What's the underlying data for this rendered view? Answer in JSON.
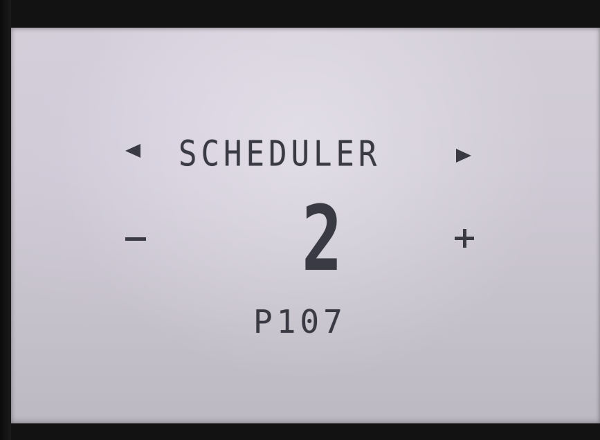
{
  "screen": {
    "title": "SCHEDULER",
    "value": "2",
    "parameter_code": "P107"
  },
  "controls": {
    "prev_icon": "left-arrow-icon",
    "next_icon": "right-arrow-icon",
    "decrease_icon": "minus-icon",
    "increase_icon": "plus-icon"
  },
  "colors": {
    "lcd_background": "#cfcad5",
    "lcd_segment": "#3a3a44",
    "bezel": "#121212"
  }
}
